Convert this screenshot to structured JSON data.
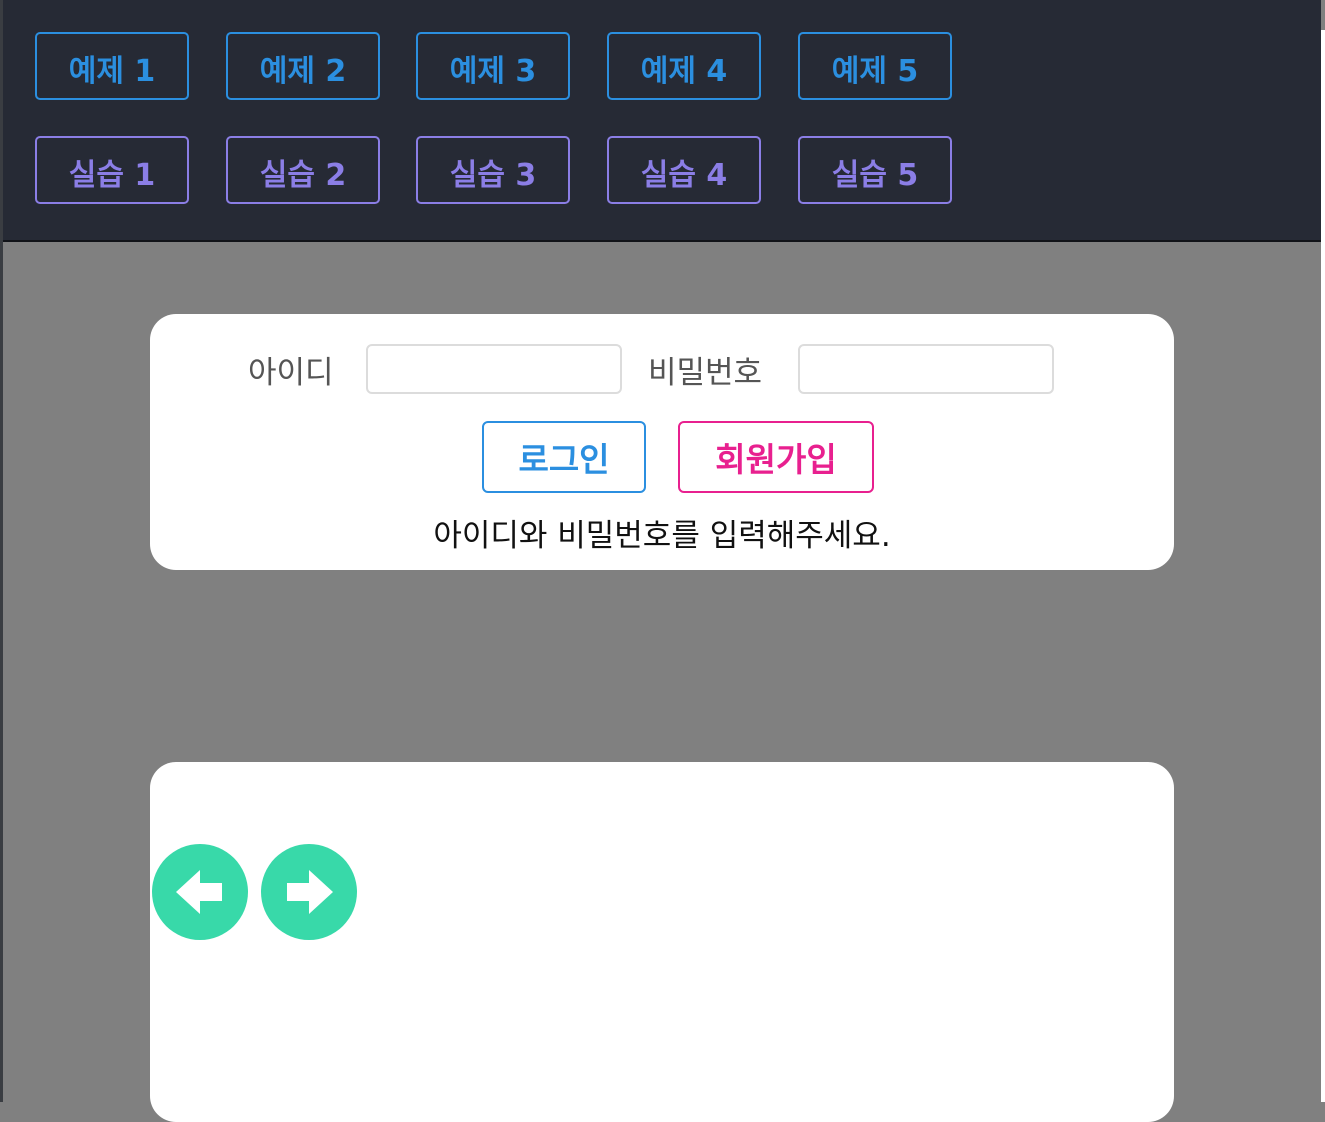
{
  "nav": {
    "examples": [
      "예제 1",
      "예제 2",
      "예제 3",
      "예제 4",
      "예제 5"
    ],
    "practices": [
      "실습 1",
      "실습 2",
      "실습 3",
      "실습 4",
      "실습 5"
    ]
  },
  "login": {
    "id_label": "아이디",
    "id_value": "",
    "password_label": "비밀번호",
    "password_value": "",
    "login_button": "로그인",
    "signup_button": "회원가입",
    "message": "아이디와 비밀번호를 입력해주세요."
  },
  "media": {
    "prev_icon": "arrow-left-icon",
    "next_icon": "arrow-right-icon"
  },
  "colors": {
    "top_bar": "#262a35",
    "example_accent": "#2b8fe0",
    "practice_accent": "#8b7ee6",
    "signup_accent": "#e8208f",
    "arrow_button": "#38d9a9",
    "page_background": "#808080"
  }
}
